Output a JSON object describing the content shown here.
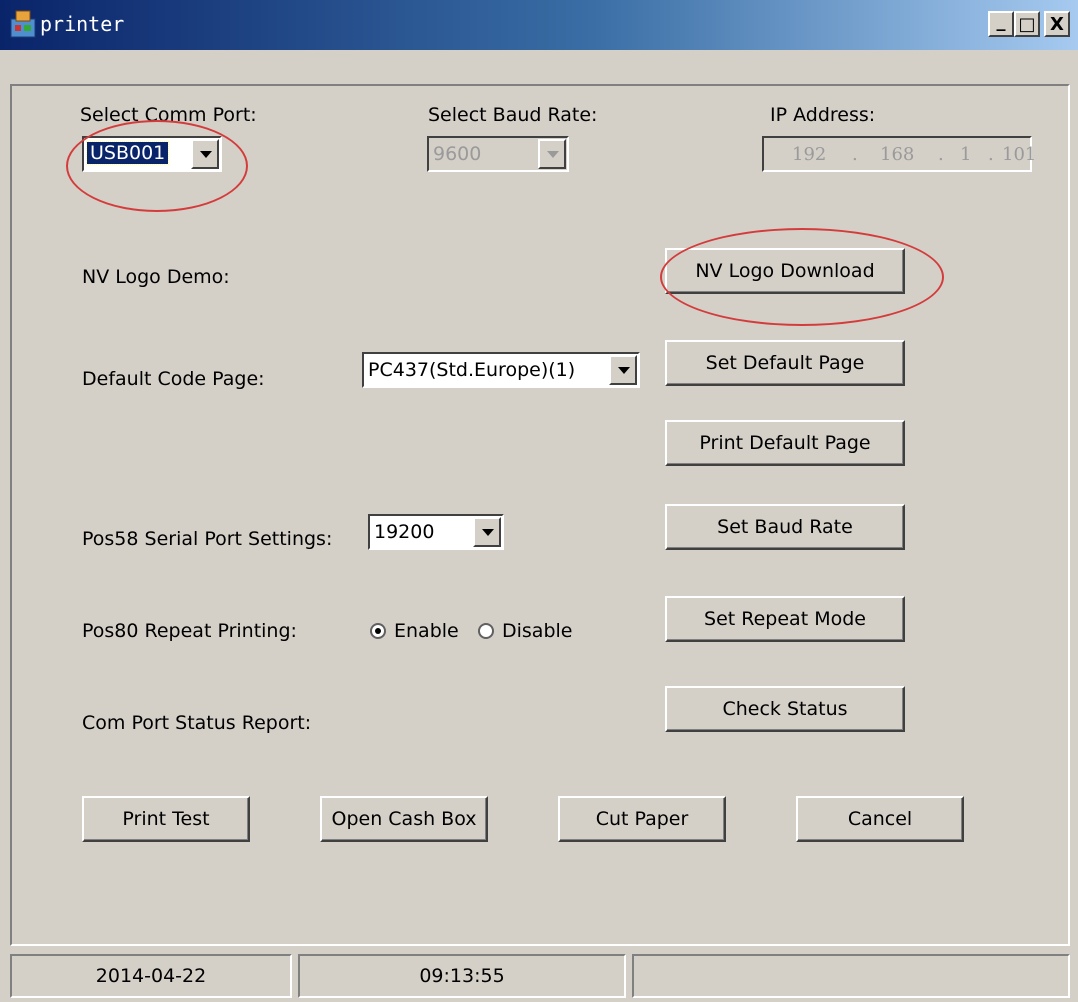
{
  "window": {
    "title": "printer",
    "app_icon": "printer-app-icon",
    "controls": {
      "minimize": "_",
      "maximize": "□",
      "close": "X"
    }
  },
  "comm_port": {
    "label": "Select Comm Port:",
    "value": "USB001"
  },
  "baud_rate": {
    "label": "Select Baud Rate:",
    "value": "9600",
    "disabled": true
  },
  "ip_address": {
    "label": "IP Address:",
    "octets": [
      "192",
      "168",
      "1",
      "101"
    ],
    "separator": ".",
    "disabled": true
  },
  "nv_logo": {
    "label": "NV Logo Demo:",
    "button": "NV Logo Download"
  },
  "code_page": {
    "label": "Default Code Page:",
    "value": "PC437(Std.Europe)(1)",
    "set_button": "Set Default Page",
    "print_button": "Print Default Page"
  },
  "pos58": {
    "label": "Pos58 Serial Port Settings:",
    "value": "19200",
    "button": "Set Baud Rate"
  },
  "pos80": {
    "label": "Pos80 Repeat Printing:",
    "enable": "Enable",
    "disable": "Disable",
    "selected": "enable",
    "button": "Set Repeat Mode"
  },
  "status_report": {
    "label": "Com Port Status Report:",
    "button": "Check Status"
  },
  "actions": {
    "print_test": "Print Test",
    "open_cash_box": "Open Cash Box",
    "cut_paper": "Cut Paper",
    "cancel": "Cancel"
  },
  "statusbar": {
    "date": "2014-04-22",
    "time": "09:13:55",
    "extra": ""
  },
  "annotation_color": "#d43c3c",
  "colors": {
    "titlebar_start": "#0a246a",
    "titlebar_end": "#a6caf0",
    "face": "#d4d0c8"
  }
}
